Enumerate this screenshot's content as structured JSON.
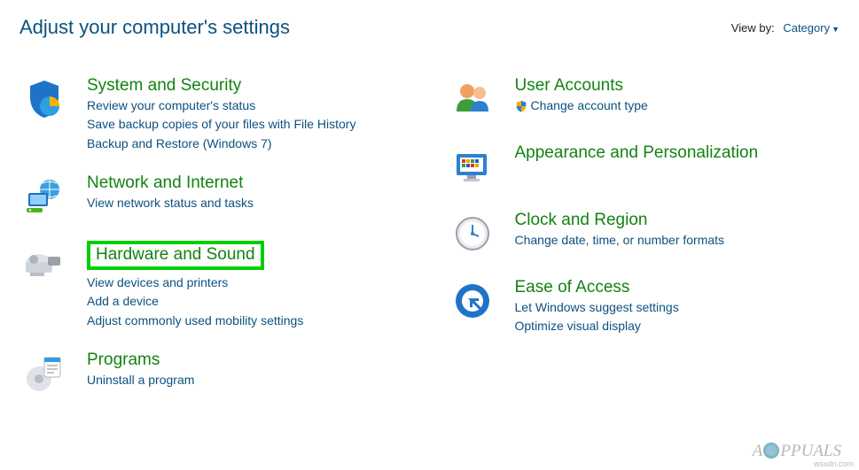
{
  "header": {
    "title": "Adjust your computer's settings",
    "viewby_label": "View by:",
    "viewby_value": "Category"
  },
  "left": [
    {
      "id": "system-security",
      "title": "System and Security",
      "links": [
        "Review your computer's status",
        "Save backup copies of your files with File History",
        "Backup and Restore (Windows 7)"
      ]
    },
    {
      "id": "network-internet",
      "title": "Network and Internet",
      "links": [
        "View network status and tasks"
      ]
    },
    {
      "id": "hardware-sound",
      "title": "Hardware and Sound",
      "highlighted": true,
      "links": [
        "View devices and printers",
        "Add a device",
        "Adjust commonly used mobility settings"
      ]
    },
    {
      "id": "programs",
      "title": "Programs",
      "links": [
        "Uninstall a program"
      ]
    }
  ],
  "right": [
    {
      "id": "user-accounts",
      "title": "User Accounts",
      "links": [
        "Change account type"
      ],
      "shield": true
    },
    {
      "id": "appearance",
      "title": "Appearance and Personalization",
      "links": []
    },
    {
      "id": "clock-region",
      "title": "Clock and Region",
      "links": [
        "Change date, time, or number formats"
      ]
    },
    {
      "id": "ease-of-access",
      "title": "Ease of Access",
      "links": [
        "Let Windows suggest settings",
        "Optimize visual display"
      ]
    }
  ],
  "watermark": "Appuals",
  "source": "wsxdn.com"
}
